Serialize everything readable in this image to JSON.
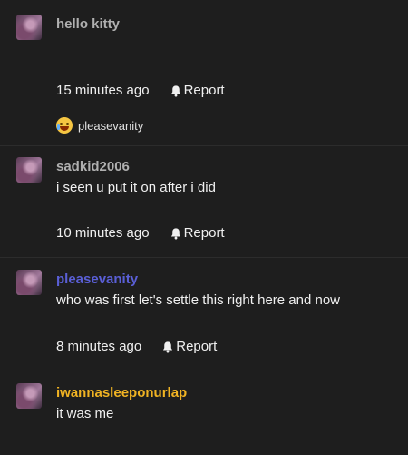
{
  "comments": [
    {
      "username": "hello kitty",
      "username_color": "#b0b0b0",
      "body": "",
      "time": "15 minutes ago",
      "report_label": "Report",
      "reaction": {
        "emoji": "laughing-crying-emoji",
        "label": "pleasevanity"
      }
    },
    {
      "username": "sadkid2006",
      "username_color": "#b0b0b0",
      "body": "i seen u put it on after i did",
      "time": "10 minutes ago",
      "report_label": "Report"
    },
    {
      "username": "pleasevanity",
      "username_color": "#5a5fd6",
      "body": "who was first let's settle this right here and now",
      "time": "8 minutes ago",
      "report_label": "Report"
    },
    {
      "username": "iwannasleeponurlap",
      "username_color": "#f0b323",
      "body": "it was me",
      "time": "",
      "report_label": ""
    }
  ]
}
